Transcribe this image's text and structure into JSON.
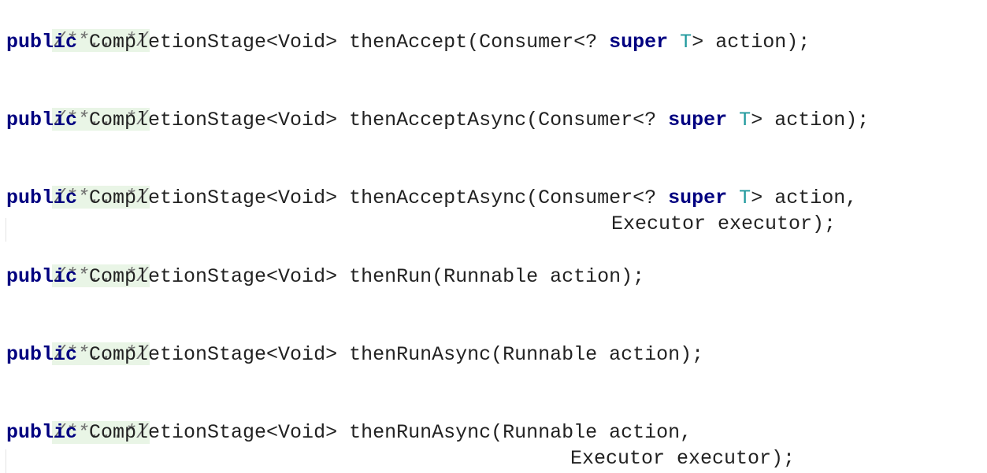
{
  "editor": {
    "fold_placeholder": "/**...*/",
    "keyword_public": "public",
    "keyword_super": "super",
    "type_param": "T",
    "blocks": [
      {
        "sig_a": " CompletionStage<Void> thenAccept(Consumer<? ",
        "sig_b": "> action);"
      },
      {
        "sig_a": " CompletionStage<Void> thenAcceptAsync(Consumer<? ",
        "sig_b": "> action);"
      },
      {
        "sig_a": " CompletionStage<Void> thenAcceptAsync(Consumer<? ",
        "sig_b": "> action,",
        "cont": "Executor executor);"
      },
      {
        "sig": " CompletionStage<Void> thenRun(Runnable action);"
      },
      {
        "sig": " CompletionStage<Void> thenRunAsync(Runnable action);"
      },
      {
        "sig": " CompletionStage<Void> thenRunAsync(Runnable action,",
        "cont": "Executor executor);"
      }
    ]
  },
  "colors": {
    "keyword": "#000080",
    "type_param": "#20999d",
    "fold_background": "#e9f5e6",
    "fold_text": "#6f6f6f",
    "text": "#222222"
  }
}
